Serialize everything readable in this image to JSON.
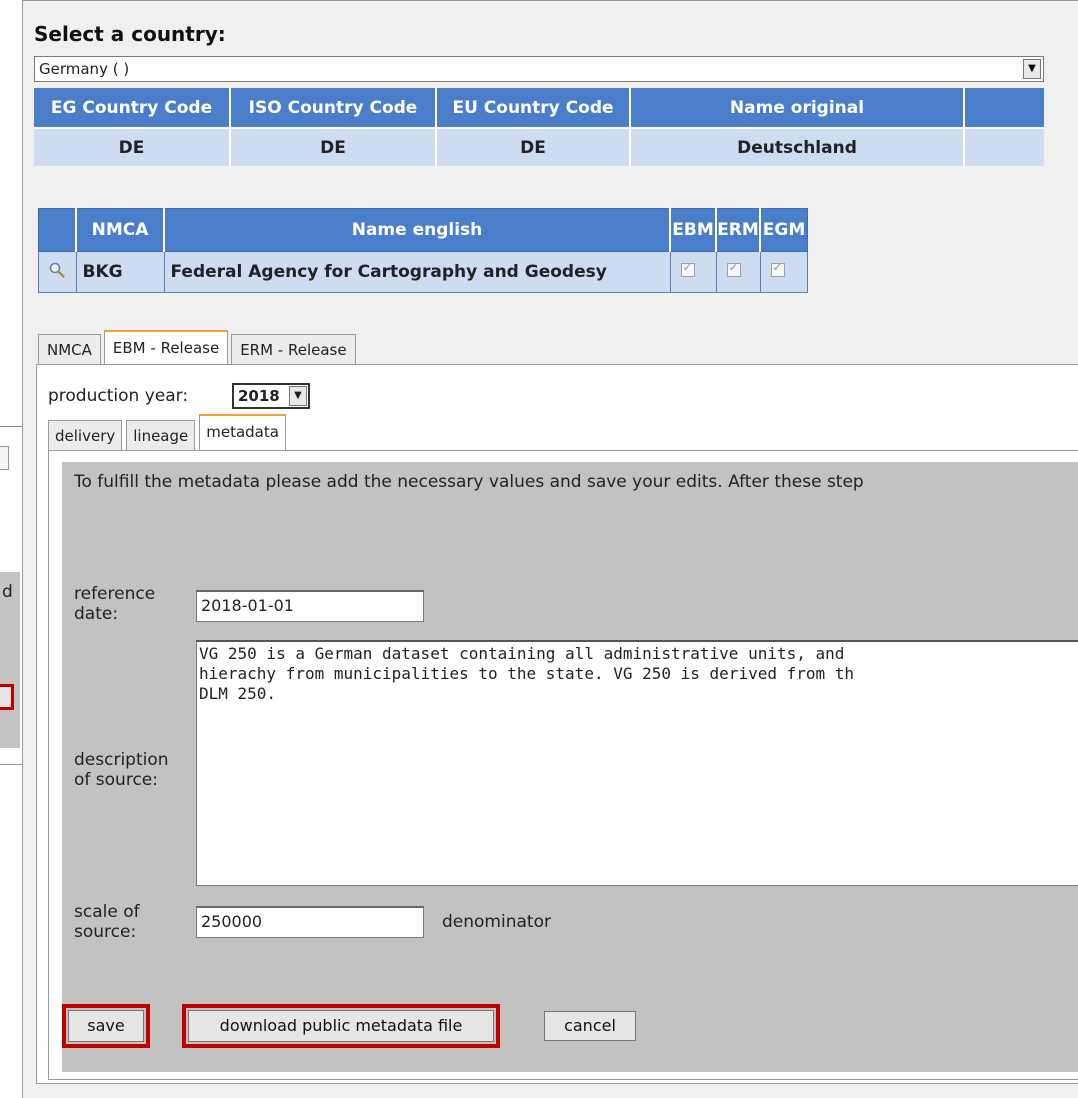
{
  "country_select": {
    "label": "Select a country:",
    "selected": "Germany ( )",
    "arrow_icon": "dropdown-arrow-icon"
  },
  "country_table": {
    "headers": [
      "EG Country Code",
      "ISO Country Code",
      "EU Country Code",
      "Name original",
      ""
    ],
    "row": [
      "DE",
      "DE",
      "DE",
      "Deutschland",
      ""
    ]
  },
  "nmca_table": {
    "headers": [
      "",
      "NMCA",
      "Name english",
      "EBM",
      "ERM",
      "EGM"
    ],
    "row": {
      "icon": "magnifier-icon",
      "nmca": "BKG",
      "name_english": "Federal Agency for Cartography and Geodesy",
      "ebm": true,
      "erm": true,
      "egm": true
    }
  },
  "release_tabs": [
    "NMCA",
    "EBM - Release",
    "ERM - Release"
  ],
  "production_year": {
    "label": "production year:",
    "value": "2018"
  },
  "sub_tabs": [
    "delivery",
    "lineage",
    "metadata"
  ],
  "metadata": {
    "intro": "To fulfill the metadata please add the necessary values and save your edits. After these step",
    "reference_date_label_1": "reference",
    "reference_date_label_2": "date:",
    "reference_date": "2018-01-01",
    "description_label_1": "description",
    "description_label_2": "of source:",
    "description": "VG 250 is a German dataset containing all administrative units, and\nhierachy from municipalities to the state. VG 250 is derived from th\nDLM 250.",
    "scale_label_1": "scale of",
    "scale_label_2": "source:",
    "scale": "250000",
    "scale_unit": "denominator"
  },
  "buttons": {
    "save": "save",
    "download": "download public metadata file",
    "cancel": "cancel"
  },
  "background_window": {
    "letter": "d"
  },
  "colors": {
    "header_blue": "#4a7ecb",
    "row_blue": "#cddcf0",
    "highlight_red": "#c00000",
    "tab_accent": "#f2a23b",
    "panel_gray": "#c2c2c2"
  }
}
